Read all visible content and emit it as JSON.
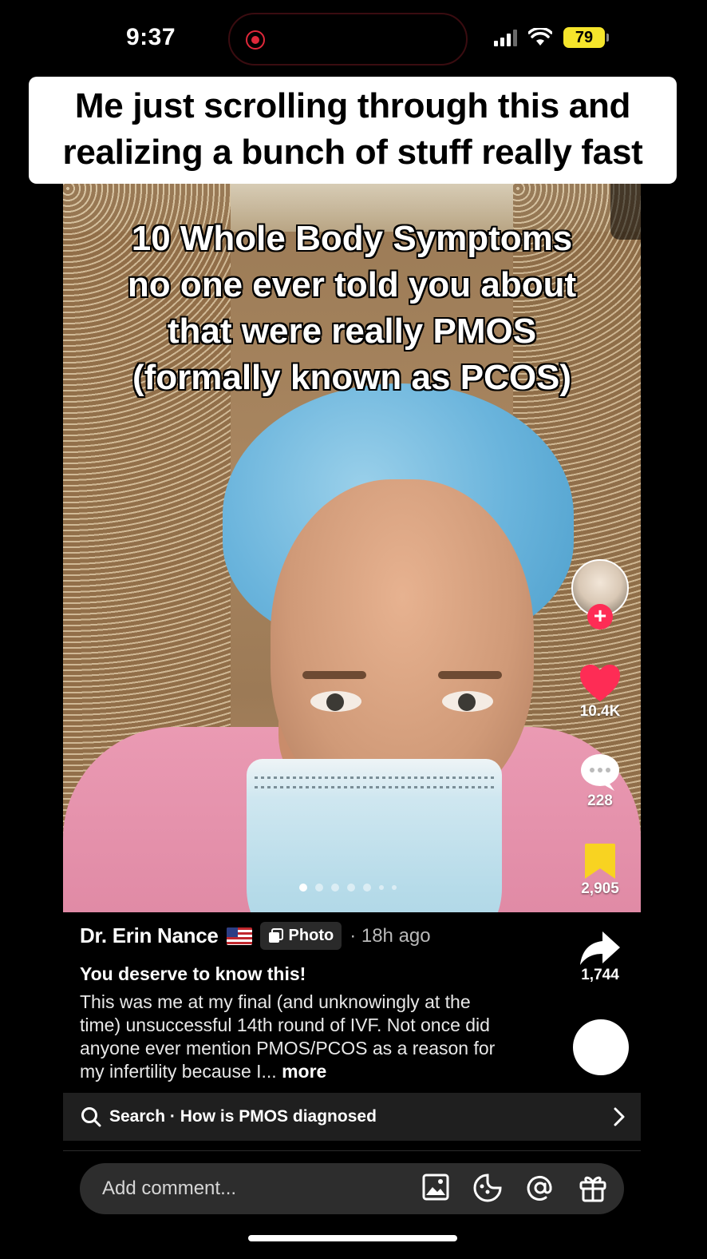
{
  "status_bar": {
    "time": "9:37",
    "battery": "79"
  },
  "banner": {
    "line1": "Me just scrolling through this and",
    "line2": "realizing a bunch of stuff really fast"
  },
  "video": {
    "overlay_lines": [
      "10 Whole Body Symptoms",
      "no one ever told you about",
      "that were really PMOS",
      "(formally known as PCOS)"
    ],
    "page_count": 7,
    "active_page": 1
  },
  "actions": {
    "like_count": "10.4K",
    "comment_count": "228",
    "save_count": "2,905",
    "share_count": "1,744",
    "follow_symbol": "+"
  },
  "post": {
    "author": "Dr. Erin Nance",
    "type_label": "Photo",
    "time_ago": "· 18h ago",
    "title": "You deserve to know this!",
    "body": "This was me at my final (and unknowingly at the time) unsuccessful 14th round of IVF. Not once did anyone ever mention PMOS/PCOS as a reason for my infertility because I...",
    "more_label": "more"
  },
  "search": {
    "label": "Search · How is PMOS diagnosed"
  },
  "comment": {
    "placeholder": "Add comment..."
  },
  "colors": {
    "like_red": "#fe2c55",
    "save_yellow": "#f8d321",
    "battery_yellow": "#f5e52b"
  },
  "icons": [
    "signal-icon",
    "wifi-icon",
    "battery-icon",
    "heart-icon",
    "comment-icon",
    "bookmark-icon",
    "share-icon",
    "search-icon",
    "chevron-right-icon",
    "image-icon",
    "emoji-icon",
    "mention-icon",
    "gift-icon",
    "photo-icon"
  ]
}
